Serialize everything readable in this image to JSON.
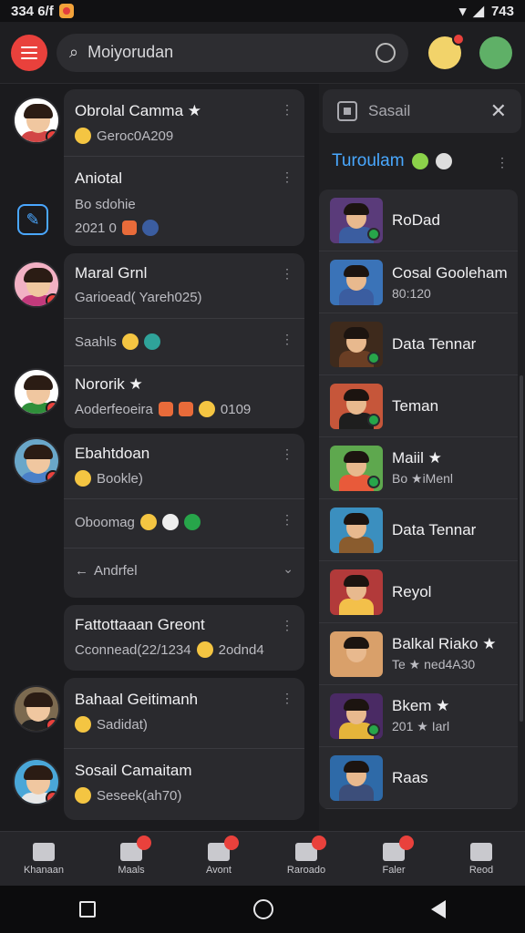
{
  "statusbar": {
    "time": "334 6/f",
    "battery": "743"
  },
  "search": {
    "value": "Moiyorudan"
  },
  "chats": [
    {
      "rows": [
        {
          "title": "Obrolal Camma ★",
          "sub": "Geroc0A209"
        },
        {
          "title": "Aniotal",
          "sub": "Bo sdohie",
          "sub2": "2021 0"
        }
      ]
    },
    {
      "rows": [
        {
          "title": "Maral Grnl",
          "sub": "Garioead( Yareh025)"
        },
        {
          "title": "Saahls",
          "sub": ""
        },
        {
          "title": "Nororik ★",
          "sub": "Aoderfeoeira",
          "sub_end": "0109"
        }
      ]
    },
    {
      "rows": [
        {
          "title": "Ebahtdoan",
          "sub": "Bookle)"
        },
        {
          "title": "Oboomag",
          "sub": ""
        },
        {
          "title": "Andrfel",
          "sub": ""
        }
      ]
    },
    {
      "rows": [
        {
          "title": "Fattottaaan Greont",
          "sub": "Cconnead(22/1234",
          "sub_end": "2odnd4"
        }
      ]
    },
    {
      "rows": [
        {
          "title": "Bahaal Geitimanh",
          "sub": "Sadidat)"
        },
        {
          "title": "Sosail Camaitam",
          "sub": "Seseek(ah70)"
        }
      ]
    }
  ],
  "right_panel": {
    "header": "Sasail",
    "title": "Turoulam",
    "items": [
      {
        "name": "RoDad",
        "sub": ""
      },
      {
        "name": "Cosal Gooleham",
        "sub": "80:120"
      },
      {
        "name": "Data Tennar",
        "sub": ""
      },
      {
        "name": "Teman",
        "sub": ""
      },
      {
        "name": "Maiil ★",
        "sub": "Bo ★iMenl"
      },
      {
        "name": "Data Tennar",
        "sub": ""
      },
      {
        "name": "Reyol",
        "sub": ""
      },
      {
        "name": "Balkal Riako ★",
        "sub": "Te ★ ned4A30"
      },
      {
        "name": "Bkem ★",
        "sub": "201 ★ Iarl"
      },
      {
        "name": "Raas",
        "sub": ""
      }
    ]
  },
  "nav": [
    {
      "label": "Khanaan"
    },
    {
      "label": "Maals"
    },
    {
      "label": "Avont"
    },
    {
      "label": "Raroado"
    },
    {
      "label": "Faler"
    },
    {
      "label": "Reod"
    }
  ],
  "colors": {
    "accent": "#e9413c",
    "link": "#49a8ff",
    "background": "#1b1b1e"
  },
  "icons": [
    "menu-icon",
    "search-icon",
    "compose-icon",
    "close-icon",
    "home-icon",
    "square-icon",
    "circle-icon",
    "back-icon"
  ]
}
